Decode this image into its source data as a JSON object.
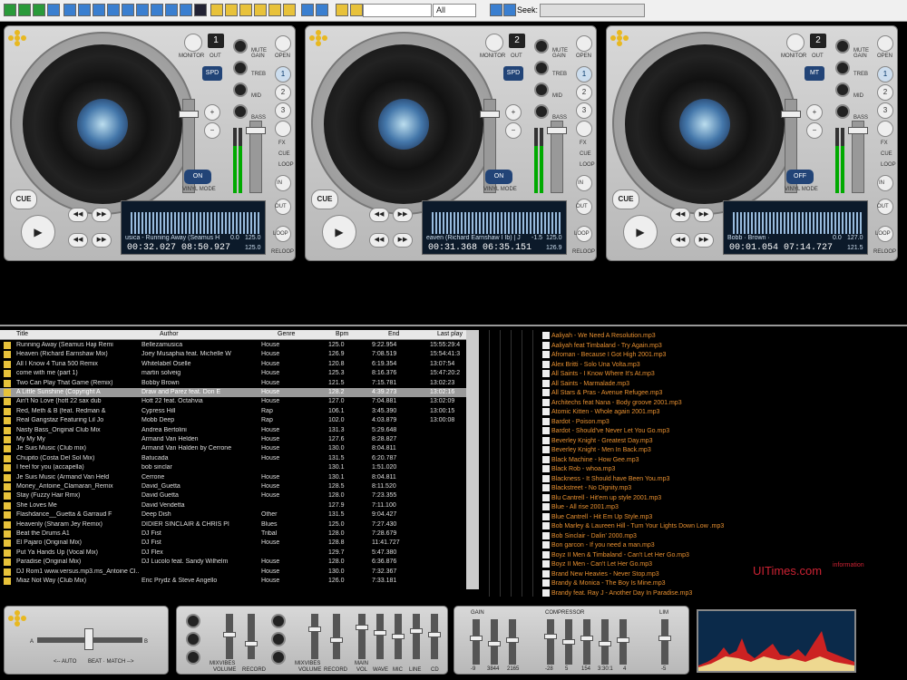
{
  "toolbar": {
    "search_value": "",
    "filter": "All",
    "seek_label": "Seek:"
  },
  "decks": [
    {
      "number": "1",
      "mode": "SPD",
      "vinyl_state": "ON",
      "title": "usica - Running Away (Seamus Haji I",
      "elapsed": "00:32.027",
      "remaining": "08:50.927",
      "pitch": "0.0",
      "bpm": "125.0",
      "bpm2": "125.0"
    },
    {
      "number": "2",
      "mode": "SPD",
      "vinyl_state": "ON",
      "title": "eaven (Richard Earnshaw I Ib) | Joe",
      "elapsed": "00:31.368",
      "remaining": "06:35.151",
      "pitch": "-1.5",
      "bpm": "125.0",
      "bpm2": "126.9"
    },
    {
      "number": "2",
      "mode": "MT",
      "vinyl_state": "OFF",
      "title": "Bobb · Brown ·",
      "elapsed": "00:01.054",
      "remaining": "07:14.727",
      "pitch": "0.0",
      "bpm": "127.0",
      "bpm2": "121.5",
      "track_a": "2",
      "track_b": "3"
    }
  ],
  "deck_labels": {
    "monitor": "MONITOR",
    "out": "OUT",
    "mute": "MUTE",
    "gain": "GAIN",
    "treb": "TREB",
    "mid": "MID",
    "bass": "BASS",
    "vinyl_mode": "VINYL MODE",
    "open": "OPEN",
    "fx": "FX",
    "cue_lbl": "CUE",
    "loop": "LOOP",
    "in": "IN",
    "reloop": "RELOOP",
    "cue": "CUE"
  },
  "playlist": {
    "headers": {
      "title": "Title",
      "author": "Author",
      "genre": "Genre",
      "bpm": "Bpm",
      "end": "End",
      "last": "Last play"
    },
    "rows": [
      [
        "Running Away (Seamus Haji Remi",
        "Bellezamusica",
        "House",
        "125.0",
        "9:22.954",
        "15:55:29:4"
      ],
      [
        "Heaven (Richard Earnshaw Mix)",
        "Joey Musaphia feat. Michelle W",
        "House",
        "126.9",
        "7:08.519",
        "15:54:41:3"
      ],
      [
        "All I Know 4 Tuna 500 Remix",
        "Whitelabel Oselle",
        "House",
        "120.8",
        "6:19.354",
        "13:07:54"
      ],
      [
        "come with me (part 1)",
        "martin solveig",
        "House",
        "125.3",
        "8:16.376",
        "15:47:20:2"
      ],
      [
        "Two Can Play That Game (Remix)",
        "Bobby Brown",
        "House",
        "121.5",
        "7:15.781",
        "13:02:23"
      ],
      [
        "A Little Sunshine (Copyright A",
        "Draw and Parez feat. Don E",
        "House",
        "128.2",
        "4:39.273",
        "13:02:16"
      ],
      [
        "Ain't No Love (hott 22 sax dub",
        "Hott 22 feat. Octahvia",
        "House",
        "127.0",
        "7:04.881",
        "13:02:09"
      ],
      [
        "Red, Meth & B (feat. Redman &",
        "Cypress Hill",
        "Rap",
        "106.1",
        "3:45.390",
        "13:00:15"
      ],
      [
        "Real Gangstaz Featuring Lil Jo",
        "Mobb Deep",
        "Rap",
        "102.0",
        "4:03.879",
        "13:00:08"
      ],
      [
        "Nasty Bass_Original Club Mix",
        "Andrea Bertolini",
        "House",
        "131.3",
        "5:29.648",
        ""
      ],
      [
        "My My My",
        "Armand Van Helden",
        "House",
        "127.6",
        "8:28.827",
        ""
      ],
      [
        "Je Suis Music (Club mix)",
        "Armand Van Halden by Cerrone",
        "House",
        "130.0",
        "8:04.811",
        ""
      ],
      [
        "Chupito (Costa Del Sol Mix)",
        "Batucada",
        "House",
        "131.5",
        "6:20.787",
        ""
      ],
      [
        "I feel for you (accapella)",
        "bob sinclar",
        "",
        "130.1",
        "1:51.020",
        ""
      ],
      [
        "Je Suis Music (Armand Van Held",
        "Cerrone",
        "House",
        "130.1",
        "8:04.811",
        ""
      ],
      [
        "Money_Antoine_Clamaran_Remix",
        "David_Guetta",
        "House",
        "128.5",
        "8:11.520",
        ""
      ],
      [
        "Stay (Fuzzy Hair Rmx)",
        "David Guetta",
        "House",
        "128.0",
        "7:23.355",
        ""
      ],
      [
        "She Loves Me",
        "David Vendetta",
        "",
        "127.9",
        "7:11.100",
        ""
      ],
      [
        "Flashdance__Guetta & Garraud F",
        "Deep Dish",
        "Other",
        "131.5",
        "9:04.427",
        ""
      ],
      [
        "Heavenly (Sharam Jey Remix)",
        "DIDIER SINCLAIR & CHRIS PI",
        "Blues",
        "125.0",
        "7:27.430",
        ""
      ],
      [
        "Beat the Drums A1",
        "DJ Fist",
        "Tribal",
        "128.0",
        "7:28.679",
        ""
      ],
      [
        "El Pajaro (Original Mix)",
        "DJ Fist",
        "House",
        "128.8",
        "11:41.727",
        ""
      ],
      [
        "Put Ya Hands Up (Vocal Mix)",
        "DJ Flex",
        "",
        "129.7",
        "5:47.380",
        ""
      ],
      [
        "Paradise (Original Mix)",
        "DJ Lucolo feat. Sandy Wilhelm",
        "House",
        "128.0",
        "6:36.876",
        ""
      ],
      [
        "DJ Rom1 www.versus.mp3.ms_Antoine Cl...",
        "",
        "House",
        "130.0",
        "7:32.367",
        ""
      ],
      [
        "Miaz Not Way (Club Mix)",
        "Eric Prydz & Steve Angello",
        "House",
        "126.0",
        "7:33.181",
        ""
      ]
    ]
  },
  "files": [
    "Aaliyah - We Need A Resolution.mp3",
    "Aaliyah feat Timbaland - Try Again.mp3",
    "Afroman - Because I Got High 2001.mp3",
    "Alex Britti - Solo Una Volta.mp3",
    "All Saints - I Know Where It's At.mp3",
    "All Saints - Marmalade.mp3",
    "All Stars & Pras - Avenue Refugee.mp3",
    "Architechs feat Nana - Body groove 2001.mp3",
    "Atomic Kitten - Whole again 2001.mp3",
    "Bardot - Poison.mp3",
    "Bardot - Should've Never Let You Go.mp3",
    "Beverley Knight - Greatest Day.mp3",
    "Beverley Knight - Men In Back.mp3",
    "Black Machine - How Gee.mp3",
    "Black Rob - whoa.mp3",
    "Blackness - It Should have Been You.mp3",
    "Blackstreet - No Dignity.mp3",
    "Blu Cantrell - Hit'em up style 2001.mp3",
    "Blue - All rise 2001.mp3",
    "Blue Cantrell - Hit Em Up Style.mp3",
    "Bob Marley & Laureen Hill - Turn Your Lights Down Low .mp3",
    "Bob Sinclair - Dalin' 2000.mp3",
    "Bon garcon - If you need a man.mp3",
    "Boyz II Men & Timbaland - Can't Let Her Go.mp3",
    "Boyz II Men - Can't Let Her Go.mp3",
    "Brand New Heavies - Never Stop.mp3",
    "Brandy & Monica - The Boy Is Mine.mp3",
    "Brandy feat. Ray J - Another Day In Paradise.mp3"
  ],
  "brand": {
    "name": "UITimes.com",
    "tag": "information"
  },
  "bottom": {
    "auto": "<-- AUTO",
    "beat": "BEAT · MATCH -->",
    "mixvibes": "MIXVIBES",
    "volume": "VOLUME",
    "record": "RECORD",
    "main": "MAIN",
    "vol": "VOL",
    "wave": "WAVE",
    "mic": "MIC",
    "line": "LINE",
    "cd": "CD",
    "gain": "GAIN",
    "compressor": "COMPRESSOR",
    "lim": "LIM",
    "a": "A",
    "b": "B",
    "gain_vals": [
      "-9",
      "3844",
      "2165"
    ],
    "comp_vals": [
      "-28",
      "5",
      "154",
      "3:30:1",
      "4"
    ],
    "lim_val": "-5"
  }
}
